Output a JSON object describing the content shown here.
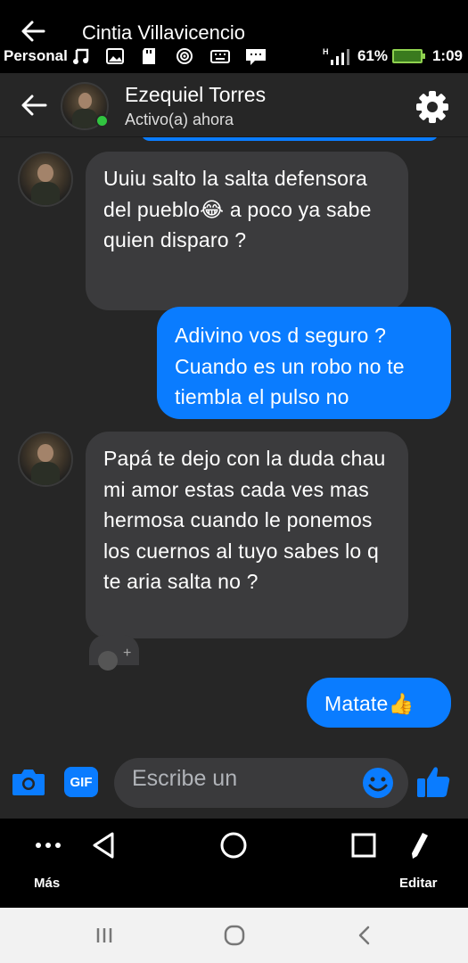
{
  "viewer": {
    "owner_name": "Cintia Villavicencio",
    "bottom_left_label": "Más",
    "bottom_right_label": "Editar"
  },
  "status_bar": {
    "carrier": "Personal",
    "battery_percent": "61%",
    "time": "1:09"
  },
  "header": {
    "contact_name": "Ezequiel Torres",
    "presence": "Activo(a) ahora"
  },
  "messages": [
    {
      "direction": "incoming",
      "text": "Uuiu salto la salta defensora del pueblo😂 a poco ya sabe quien disparo ?"
    },
    {
      "direction": "outgoing",
      "text": "Adivino vos d seguro ? Cuando es un robo no te tiembla el pulso no"
    },
    {
      "direction": "incoming",
      "text": "Papá te dejo con la duda chau mi amor estas cada ves mas hermosa cuando le ponemos los cuernos al tuyo sabes lo q te aria salta no ?"
    },
    {
      "direction": "outgoing",
      "text": "Matate👍"
    }
  ],
  "composer": {
    "gif_label": "GIF",
    "placeholder": "Escribe un"
  },
  "colors": {
    "accent": "#0a7cff",
    "background": "#262626",
    "incoming_bubble": "#3b3b3d",
    "online": "#31c440"
  }
}
